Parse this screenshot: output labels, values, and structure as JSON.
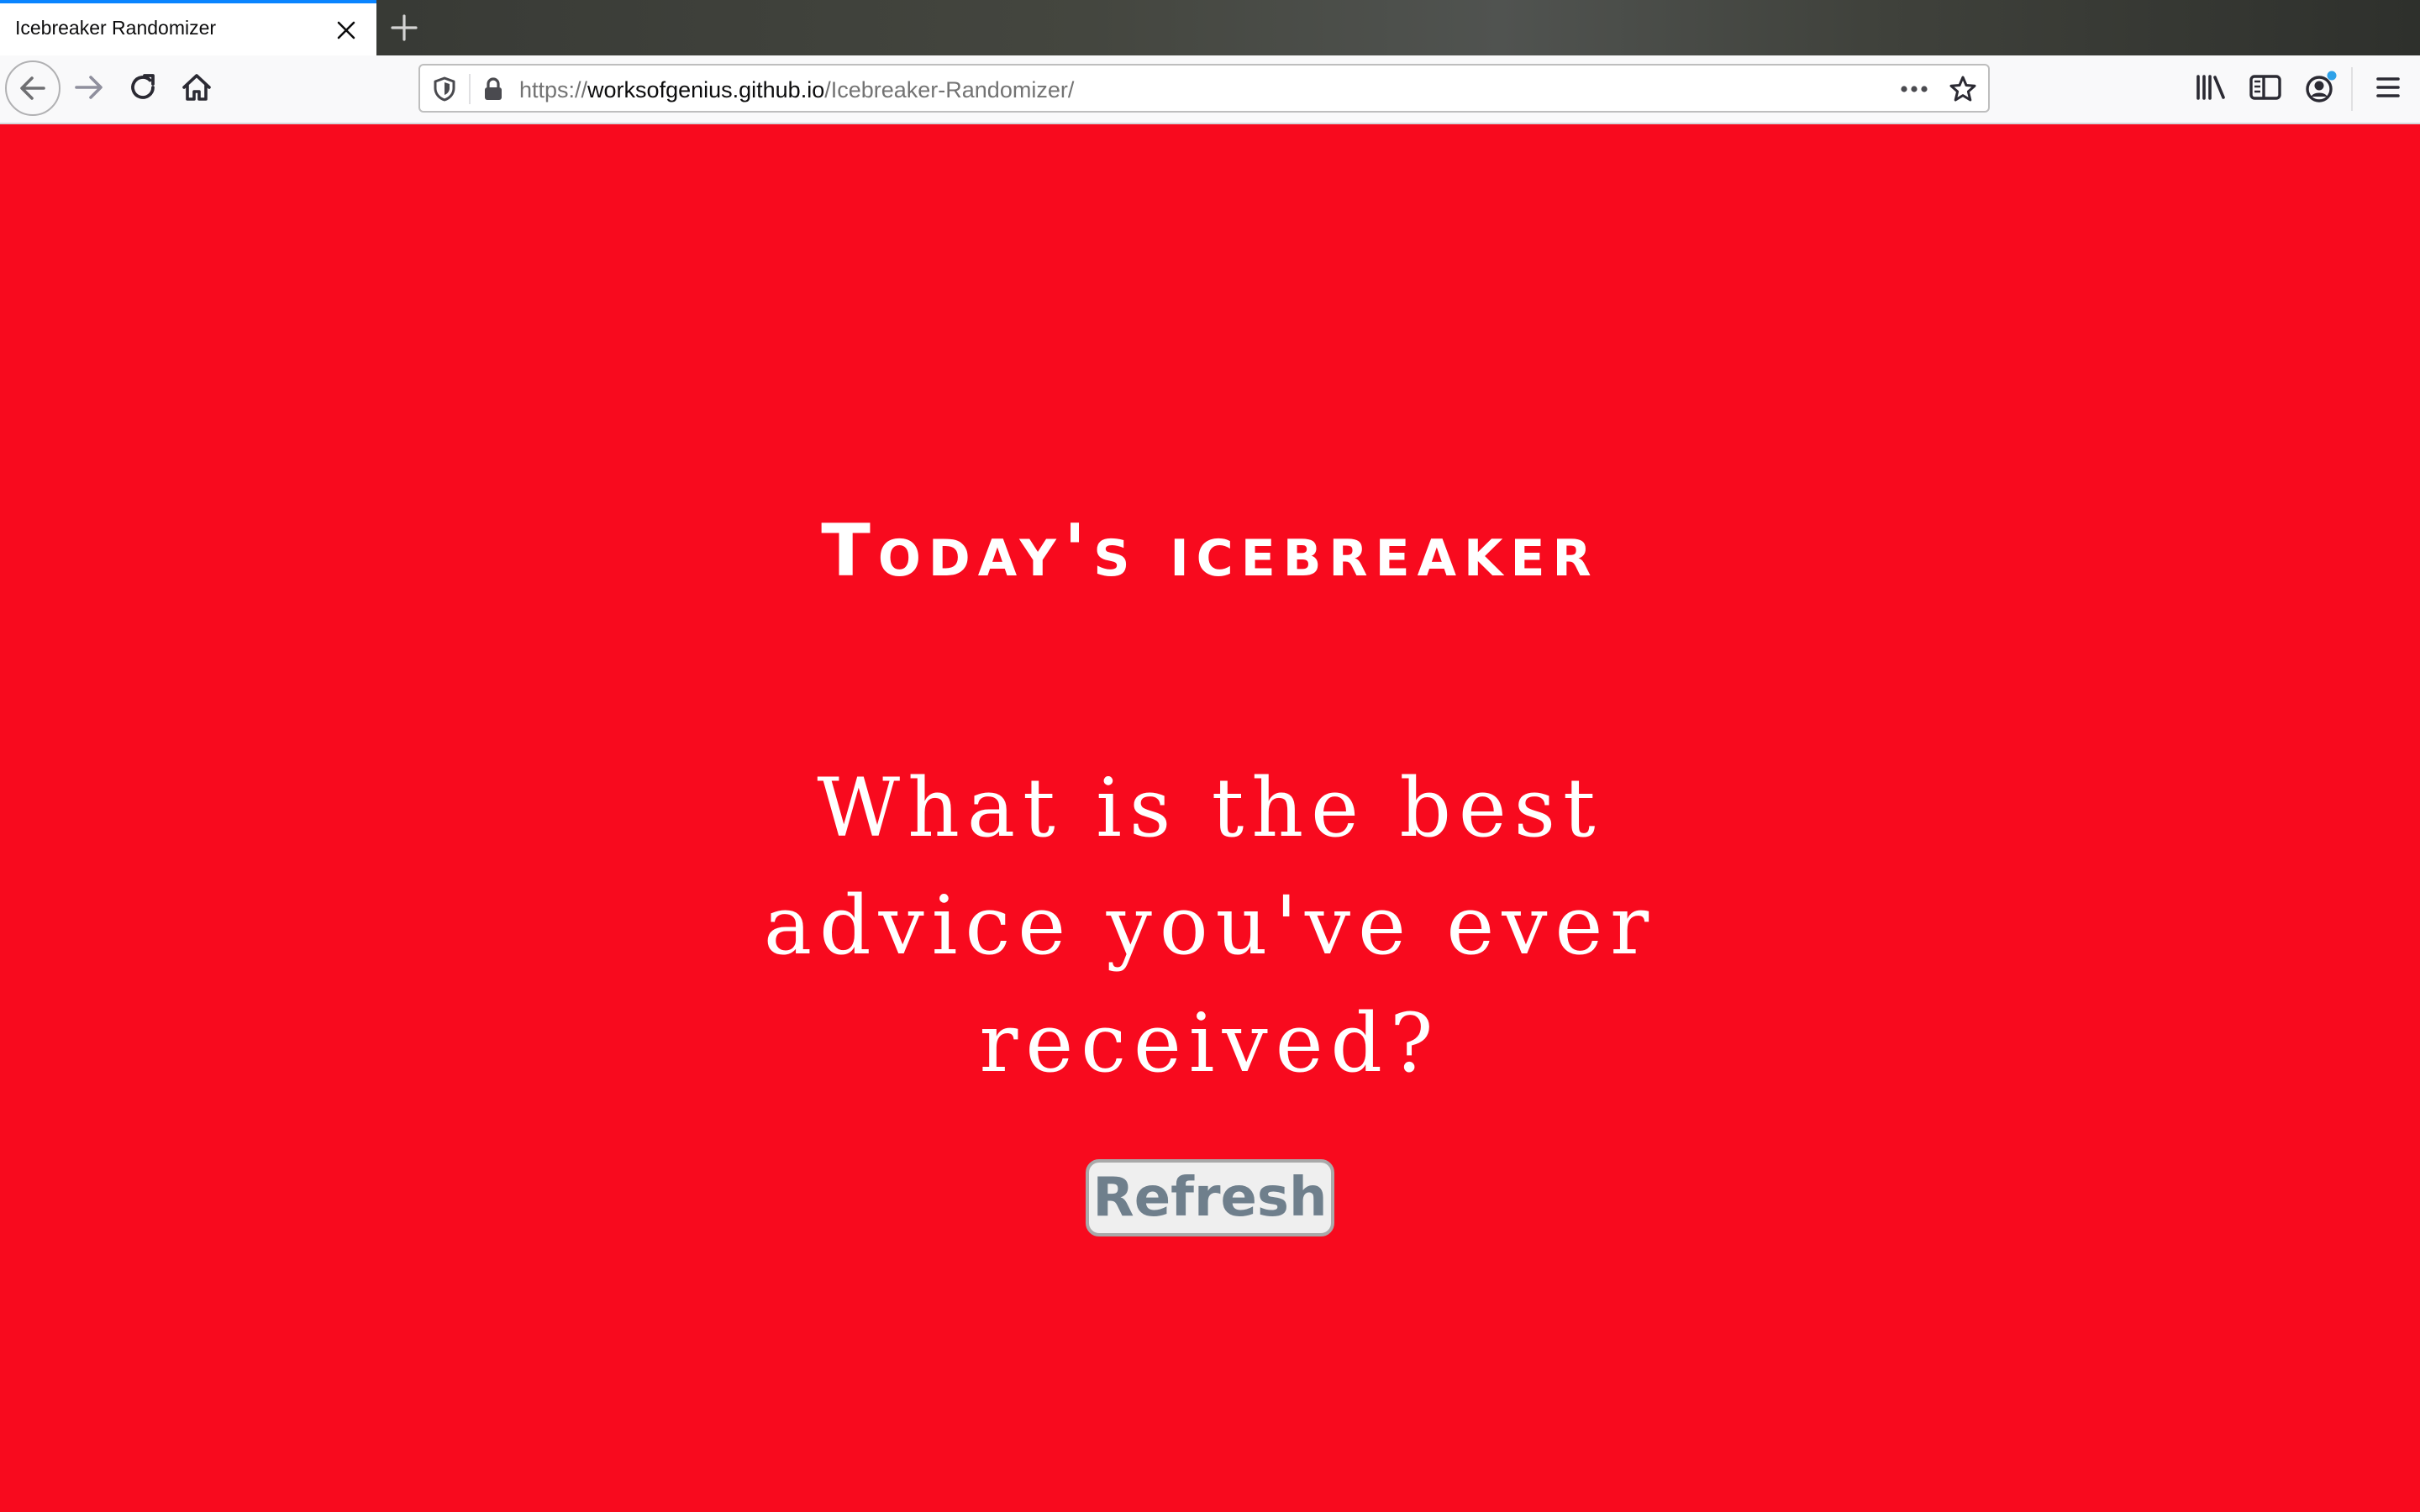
{
  "browser": {
    "tab": {
      "title": "Icebreaker Randomizer"
    },
    "url": {
      "scheme": "https://",
      "host": "worksofgenius.github.io",
      "path": "/Icebreaker-Randomizer/"
    },
    "colors": {
      "accent": "#0a84ff",
      "sync_dot": "#2ea1e8"
    }
  },
  "page": {
    "heading": "Today's icebreaker",
    "question": "What is the best advice you've ever received?",
    "refresh_label": "Refresh",
    "colors": {
      "background": "#f80a1e",
      "text": "#ffffff",
      "button_text": "#6f7f8c"
    }
  }
}
